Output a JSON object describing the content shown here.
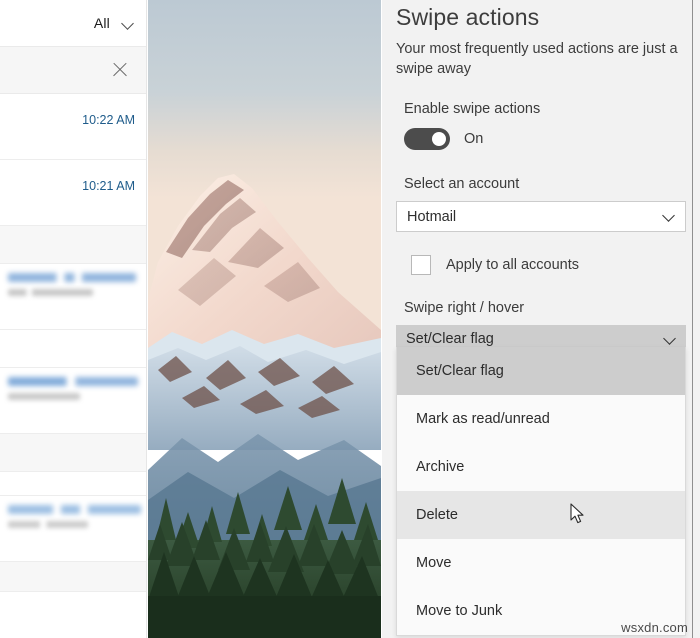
{
  "mail_list": {
    "filter_label": "All",
    "filter_icon": "chevron-down-icon",
    "close_icon": "close-icon",
    "rows": [
      {
        "time": "10:22 AM"
      },
      {
        "time": "10:21 AM"
      }
    ]
  },
  "photo": {
    "description": "Snow-capped mountain at sunset above pine forest"
  },
  "settings": {
    "title": "Swipe actions",
    "subtitle": "Your most frequently used actions are just a swipe away",
    "enable": {
      "label": "Enable swipe actions",
      "state": "On",
      "checked": true
    },
    "account": {
      "label": "Select an account",
      "value": "Hotmail",
      "chevron_icon": "chevron-down-icon"
    },
    "apply_all": {
      "label": "Apply to all accounts",
      "checked": false
    },
    "swipe_right": {
      "label": "Swipe right / hover",
      "value": "Set/Clear flag",
      "chevron_icon": "chevron-down-icon",
      "options": [
        {
          "label": "Set/Clear flag",
          "state": "selected"
        },
        {
          "label": "Mark as read/unread",
          "state": "normal"
        },
        {
          "label": "Archive",
          "state": "normal"
        },
        {
          "label": "Delete",
          "state": "hovered"
        },
        {
          "label": "Move",
          "state": "normal"
        },
        {
          "label": "Move to Junk",
          "state": "normal"
        }
      ]
    }
  },
  "watermark": "wsxdn.com",
  "colors": {
    "pane_bg": "#f2f2f2",
    "accent_time": "#1f5c8b",
    "toggle_on": "#4c4c4c",
    "selected_item": "#cdcdcd",
    "hovered_item": "#e6e6e6"
  }
}
